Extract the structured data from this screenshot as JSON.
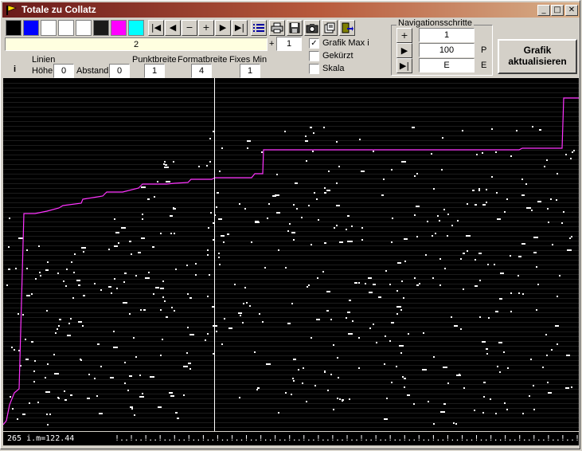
{
  "window": {
    "title": "Totale zu Collatz"
  },
  "caption_buttons": {
    "minimize": "_",
    "maximize": "□",
    "close": "✕"
  },
  "palette": [
    "#000000",
    "#0000ff",
    "#ffffff",
    "#ffffff",
    "#ffffff",
    "#1a1a1a",
    "#ff00ff",
    "#00ffff"
  ],
  "toolbar": {
    "nav": [
      "|◀",
      "◀",
      "−",
      "+",
      "▶",
      "▶|"
    ],
    "number_value": "2",
    "plus_label": "+",
    "step_value": "1"
  },
  "checkboxes": [
    {
      "label": "Grafik Max i",
      "checked": "✓"
    },
    {
      "label": "Gekürzt",
      "checked": ""
    },
    {
      "label": "Skala",
      "checked": ""
    }
  ],
  "params": {
    "i_label": "i",
    "linien_label": "Linien",
    "hoehe_label": "Höhe",
    "hoehe_value": "0",
    "abstand_label": "Abstand",
    "abstand_value": "0",
    "punktbreite_label": "Punktbreite",
    "punktbreite_value": "1",
    "formatbreite_label": "Formatbreite",
    "formatbreite_value": "4",
    "fixesmin_label": "Fixes Min",
    "fixesmin_value": "1"
  },
  "navigation": {
    "title": "Navigationsschritte",
    "rows": [
      {
        "button": "+",
        "value": "1",
        "unit": ""
      },
      {
        "button": "▶",
        "value": "100",
        "unit": "P"
      },
      {
        "button": "▶|",
        "value": "E",
        "unit": "E"
      }
    ]
  },
  "update_button": {
    "line1": "Grafik",
    "line2": "aktualisieren"
  },
  "plot": {
    "background": "#000000",
    "line_color": "#ff33ff",
    "cursor_color": "#ffffff"
  },
  "status": {
    "readout": "265 i.m=122.44",
    "ruler": "!..!..!..!..!..!..!..!..!..!..!..!..!..!..!..!..!..!..!..!..!..!..!..!..!..!..!..!..!..!..!..!..!..!"
  }
}
